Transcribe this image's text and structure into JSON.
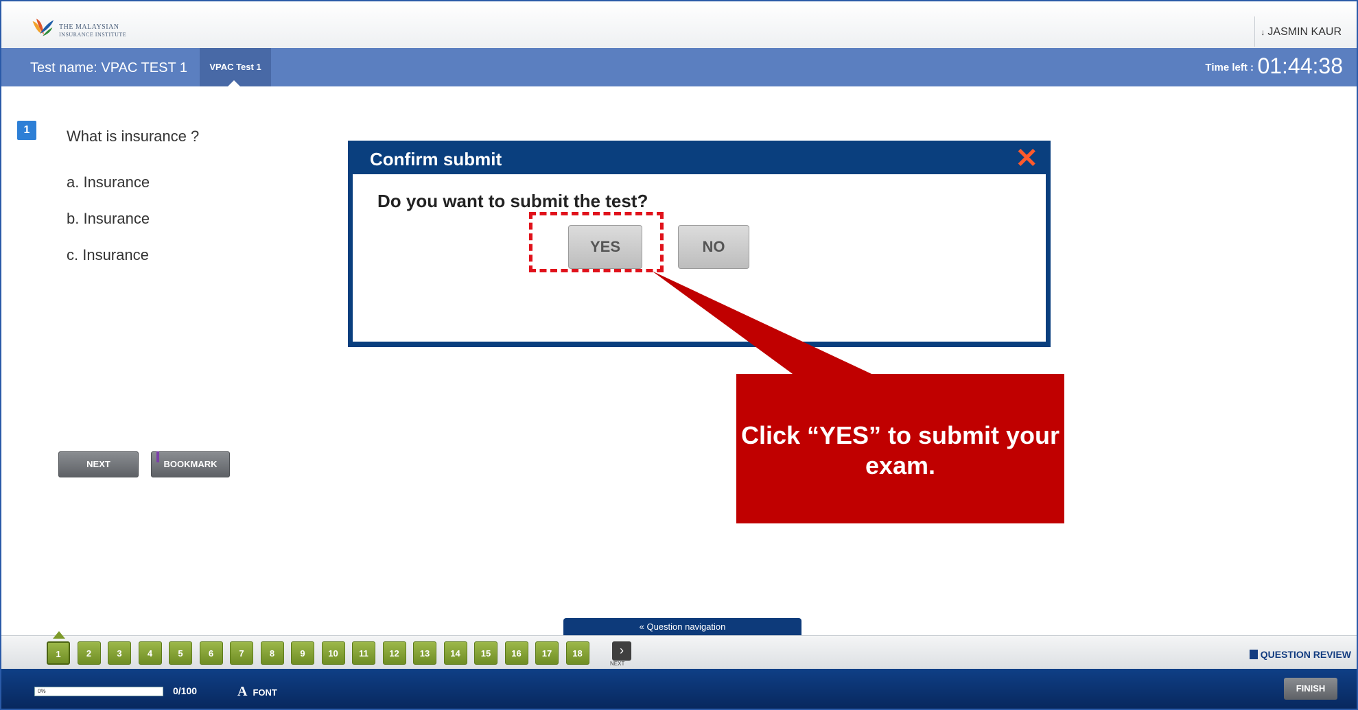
{
  "header": {
    "logo_line1": "THE MALAYSIAN",
    "logo_line2": "INSURANCE INSTITUTE",
    "user": "JASMIN KAUR",
    "user_icon": "caret-down-icon"
  },
  "testbar": {
    "test_name": "Test name: VPAC TEST 1",
    "tab_label": "VPAC Test 1",
    "time_left_label": "Time left :",
    "time_left": "01:44:38"
  },
  "question": {
    "number": "1",
    "text": "What is insurance ?",
    "options": [
      "a. Insurance",
      "b. Insurance",
      "c. Insurance"
    ],
    "next_label": "NEXT",
    "bookmark_label": "BOOKMARK"
  },
  "dialog": {
    "title": "Confirm submit",
    "message": "Do you want to submit the test?",
    "yes_label": "YES",
    "no_label": "NO",
    "close_icon": "close-icon",
    "close_color": "#ff5a2c"
  },
  "callout": {
    "text": "Click “YES” to submit your exam.",
    "color": "#c00000"
  },
  "navigation": {
    "tab_label": "« Question navigation",
    "questions": [
      "1",
      "2",
      "3",
      "4",
      "5",
      "6",
      "7",
      "8",
      "9",
      "10",
      "11",
      "12",
      "13",
      "14",
      "15",
      "16",
      "17",
      "18"
    ],
    "next_label": "NEXT",
    "question_review_label": "QUESTION REVIEW"
  },
  "footer": {
    "progress_label": "0%",
    "progress_value": 0,
    "score": "0/100",
    "font_label": "FONT",
    "finish_label": "FINISH"
  },
  "colors": {
    "accent": "#5b7fc0",
    "dialog_header": "#0a3f7e",
    "nav_button": "#7d9a2a",
    "footer": "#0f3f86"
  }
}
